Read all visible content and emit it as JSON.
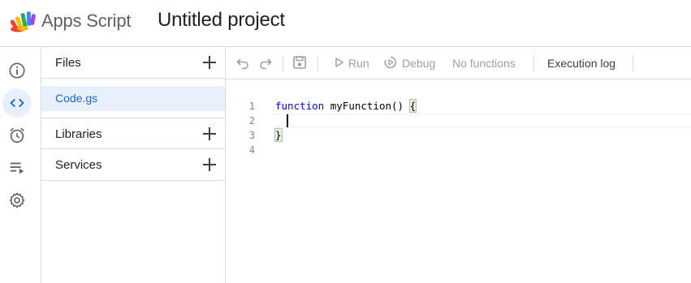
{
  "header": {
    "app_name": "Apps Script",
    "project_name": "Untitled project",
    "logo_icon": "apps-script-logo"
  },
  "rail": {
    "items": [
      {
        "icon": "info-icon",
        "label": "Overview"
      },
      {
        "icon": "code-icon",
        "label": "Editor",
        "active": true
      },
      {
        "icon": "alarm-icon",
        "label": "Triggers"
      },
      {
        "icon": "executions-icon",
        "label": "Executions"
      },
      {
        "icon": "gear-icon",
        "label": "Project Settings"
      }
    ]
  },
  "files_panel": {
    "files_label": "Files",
    "files": [
      "Code.gs"
    ],
    "libraries_label": "Libraries",
    "services_label": "Services"
  },
  "toolbar": {
    "run_label": "Run",
    "debug_label": "Debug",
    "function_select": "No functions",
    "execution_log_label": "Execution log"
  },
  "editor": {
    "line_numbers": [
      "1",
      "2",
      "3",
      "4"
    ],
    "keyword": "function",
    "function_signature": " myFunction() ",
    "open_brace": "{",
    "close_brace": "}"
  },
  "colors": {
    "accent": "#1967d2",
    "active_bg": "#e8f0fe",
    "border": "#dadce0",
    "disabled_text": "#9aa0a6"
  }
}
